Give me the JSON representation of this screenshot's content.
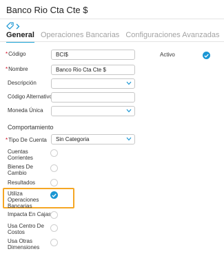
{
  "header": {
    "title": "Banco Rio Cta Cte $"
  },
  "tabs": [
    {
      "label": "General",
      "active": true
    },
    {
      "label": "Operaciones Bancarias",
      "active": false
    },
    {
      "label": "Configuraciones Avanzadas",
      "active": false
    }
  ],
  "fields": {
    "codigo": {
      "label": "Código",
      "value": "BCI$",
      "required": true
    },
    "nombre": {
      "label": "Nombre",
      "value": "Banco Rio Cta Cte $",
      "required": true
    },
    "descripcion": {
      "label": "Descripción",
      "value": ""
    },
    "codigo_alternativo": {
      "label": "Código Alternativo",
      "value": ""
    },
    "moneda_unica": {
      "label": "Moneda Única",
      "value": ""
    },
    "activo": {
      "label": "Activo",
      "checked": true
    }
  },
  "comportamiento": {
    "section_title": "Comportamiento",
    "tipo_de_cuenta": {
      "label": "Tipo De Cuenta",
      "value": "Sin Categoria",
      "required": true
    },
    "options": [
      {
        "label": "Cuentas Corrientes",
        "checked": false
      },
      {
        "label": "Bienes De Cambio",
        "checked": false
      },
      {
        "label": "Resultados",
        "checked": false
      },
      {
        "label": "Utiliza Operaciones Bancarias",
        "checked": true,
        "highlighted": true
      },
      {
        "label": "Impacta En Cajas",
        "checked": false
      },
      {
        "label": "Usa Centro De Costos",
        "checked": false
      },
      {
        "label": "Usa Otras Dimensiones",
        "checked": false
      }
    ]
  },
  "colors": {
    "accent": "#1a96d4",
    "tab_underline": "#19a3d6",
    "highlight": "#f5a623",
    "required": "#d0021b"
  }
}
